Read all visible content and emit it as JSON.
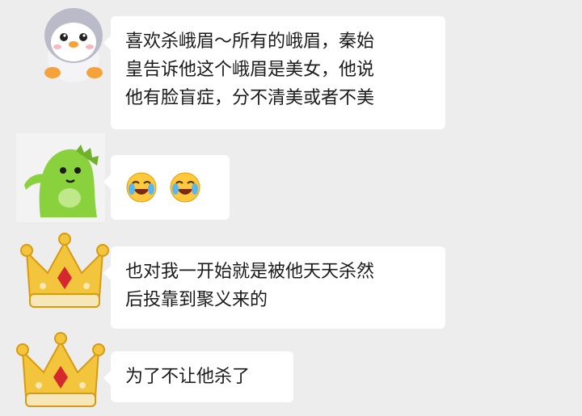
{
  "messages": [
    {
      "avatar": "penguin-avatar-icon",
      "lines": [
        "喜欢杀峨眉～所有的峨眉，秦始",
        "皇告诉他这个峨眉是美女，他说",
        "他有脸盲症，分不清美或者不美"
      ]
    },
    {
      "avatar": "green-dinosaur-avatar-icon",
      "emojis": [
        "laughing-crying-emoji-icon",
        "laughing-crying-emoji-icon"
      ]
    },
    {
      "avatar": "golden-crown-avatar-icon",
      "lines": [
        "也对我一开始就是被他天天杀然",
        "后投靠到聚义来的"
      ]
    },
    {
      "avatar": "golden-crown-avatar-icon",
      "lines": [
        "为了不让他杀了"
      ]
    }
  ],
  "colors": {
    "background": "#ededed",
    "bubble": "#ffffff",
    "text": "#1a1a1a"
  }
}
